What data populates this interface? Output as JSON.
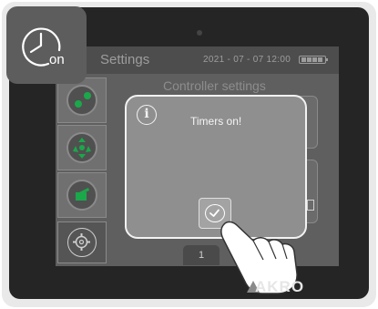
{
  "header": {
    "title": "Settings",
    "datetime": "2021 - 07 - 07  12:00"
  },
  "content": {
    "title": "Controller settings"
  },
  "dialog": {
    "message": "Timers on!",
    "info_glyph": "i"
  },
  "pager": {
    "page": "1"
  },
  "brand": {
    "logo_text": "AKRO"
  },
  "badge": {
    "label": "on"
  },
  "colors": {
    "accent_green": "#1aa84a",
    "dialog_border": "#f2f2f2"
  }
}
